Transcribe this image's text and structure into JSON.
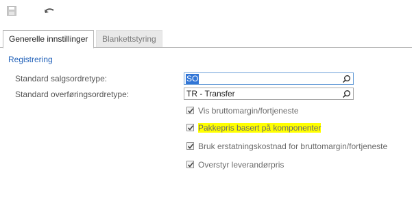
{
  "toolbar": {
    "save_icon": "save-icon",
    "undo_icon": "undo-icon"
  },
  "tabs": [
    {
      "label": "Generelle innstillinger",
      "active": true
    },
    {
      "label": "Blankettstyring",
      "active": false
    }
  ],
  "section": {
    "title": "Registrering"
  },
  "fields": [
    {
      "label": "Standard salgsordretype:",
      "value": "SO",
      "selected": true,
      "icon": "search-icon"
    },
    {
      "label": "Standard overføringsordretype:",
      "value": "TR - Transfer",
      "selected": false,
      "icon": "search-icon"
    }
  ],
  "checkboxes": [
    {
      "label": "Vis bruttomargin/fortjeneste",
      "checked": true,
      "highlighted": false
    },
    {
      "label": "Pakkepris basert på komponenter",
      "checked": true,
      "highlighted": true,
      "highlight_color": "#ffff00"
    },
    {
      "label": "Bruk erstatningskostnad for bruttomargin/fortjeneste",
      "checked": true,
      "highlighted": false
    },
    {
      "label": "Overstyr leverandørpris",
      "checked": true,
      "highlighted": false
    }
  ],
  "colors": {
    "section_title": "#2161b9",
    "selection": "#3175d6",
    "highlight": "#ffff00"
  }
}
